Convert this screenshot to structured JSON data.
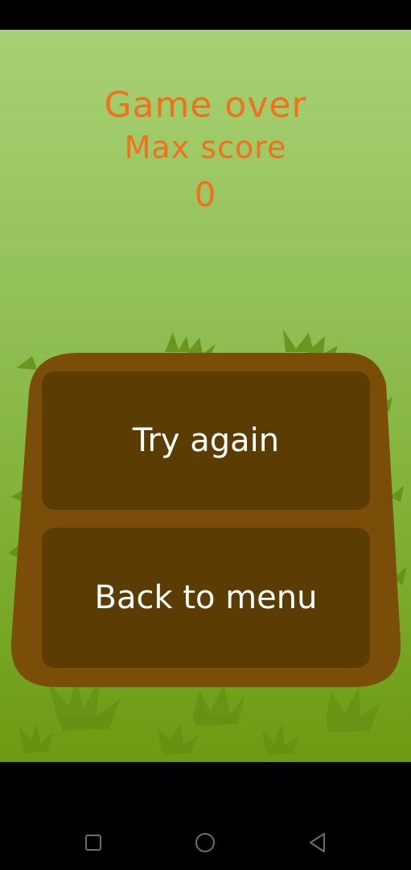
{
  "game_over": {
    "title": "Game over",
    "max_score_label": "Max score",
    "max_score_value": "0"
  },
  "menu": {
    "try_again_label": "Try again",
    "back_to_menu_label": "Back to menu"
  },
  "colors": {
    "title_text": "#f2701b",
    "panel_frame": "#7a4d08",
    "panel_button": "#5b3c03",
    "button_text": "#ffffff",
    "grass": "#5f8a10"
  },
  "nav_bar": {
    "icons": [
      "square-recents-icon",
      "circle-home-icon",
      "triangle-back-icon"
    ]
  }
}
